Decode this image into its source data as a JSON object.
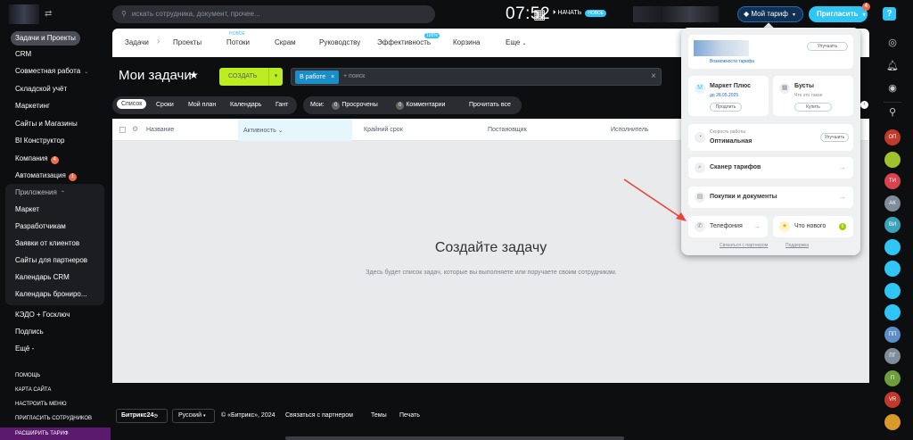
{
  "topbar": {
    "search_placeholder": "искать сотрудника, документ, прочее...",
    "clock": "07:52",
    "start_label": "НАЧАТЬ",
    "start_badge": "НОВОЕ",
    "tariff_label": "Мой тариф",
    "invite_label": "Пригласить",
    "invite_count": "4",
    "help": "?"
  },
  "sidebar": {
    "items": [
      {
        "label": "Задачи и Проекты"
      },
      {
        "label": "CRM"
      },
      {
        "label": "Совместная работа"
      },
      {
        "label": "Складской учёт"
      },
      {
        "label": "Маркетинг"
      },
      {
        "label": "Сайты и Магазины"
      },
      {
        "label": "BI Конструктор"
      },
      {
        "label": "Компания",
        "badge": "4"
      },
      {
        "label": "Автоматизация",
        "badge": "1"
      }
    ],
    "apps_header": "Приложения",
    "apps": [
      "Маркет",
      "Разработчикам",
      "Заявки от клиентов",
      "Сайты для партнеров",
      "Календарь CRM",
      "Календарь брониро..."
    ],
    "extra": [
      "КЭДО + Госключ",
      "Подпись",
      "Ещё -"
    ],
    "small_links": [
      "ПОМОЩЬ",
      "КАРТА САЙТА",
      "НАСТРОИТЬ МЕНЮ",
      "ПРИГЛАСИТЬ СОТРУДНИКОВ"
    ],
    "bottom_label": "РАСШИРИТЬ ТАРИФ"
  },
  "nav": {
    "items": [
      "Задачи",
      "Проекты",
      "Потоки",
      "Скрам",
      "Руководству",
      "Эффективность",
      "Корзина",
      "Еще"
    ],
    "new_badge": "НОВОЕ",
    "pct_badge": "100%"
  },
  "title": {
    "page_title": "Мои задачи",
    "create_label": "СОЗДАТЬ",
    "filter_tag": "В работе",
    "filter_placeholder": "+ поиск"
  },
  "views": {
    "items": [
      "Список",
      "Сроки",
      "Мой план",
      "Календарь",
      "Гант"
    ],
    "mine_label": "Мои:",
    "overdue_count": "0",
    "overdue_label": "Просрочены",
    "comments_count": "0",
    "comments_label": "Комментарии",
    "read_all": "Прочитать все"
  },
  "table": {
    "columns": [
      "Название",
      "Активность",
      "Крайний срок",
      "Постановщик",
      "Исполнитель"
    ],
    "empty_title": "Создайте задачу",
    "empty_desc": "Здесь будет список задач, которые вы выполняете или поручаете своим сотрудникам."
  },
  "footer": {
    "logo": "Битрикс24",
    "lang": "Русский",
    "copyright": "© «Битрикс», 2024",
    "partner": "Связаться с партнером",
    "themes": "Темы",
    "print": "Печать"
  },
  "rail": {
    "avatars": [
      {
        "label": "ОП",
        "color": "#c0392b"
      },
      {
        "label": "",
        "color": "#9fc22d"
      },
      {
        "label": "ТИ",
        "color": "#d9434f"
      },
      {
        "label": "АК",
        "color": "#7f8c9a"
      },
      {
        "label": "ВИ",
        "color": "#3aa3b8"
      },
      {
        "label": "",
        "color": "#2fc6f6"
      },
      {
        "label": "",
        "color": "#2fc6f6"
      },
      {
        "label": "",
        "color": "#2fc6f6"
      },
      {
        "label": "",
        "color": "#2fc6f6"
      },
      {
        "label": "ПП",
        "color": "#5b8fc6"
      },
      {
        "label": "ПГ",
        "color": "#7f8c9a"
      },
      {
        "label": "П",
        "color": "#6c9e3b"
      },
      {
        "label": "VR",
        "color": "#c0392b"
      },
      {
        "label": "",
        "color": "#d99a2b"
      }
    ]
  },
  "popup": {
    "improve_btn": "Улучшить",
    "features_link": "Возможности тарифа",
    "market_title": "Маркет Плюс",
    "market_until": "до 26.05.2025",
    "market_btn": "Продлить",
    "boost_title": "Бусты",
    "boost_link": "Что это такое",
    "boost_btn": "Купить",
    "speed_label": "Скорость работы",
    "speed_value": "Оптимальная",
    "speed_btn": "Улучшить",
    "scanner": "Сканер тарифов",
    "purchases": "Покупки и документы",
    "telephony": "Телефония",
    "whatsnew": "Что нового",
    "whatsnew_badge": "6",
    "partner_link": "Связаться с партнером",
    "support_link": "Поддержка"
  },
  "colors": {
    "accent": "#2fc6f6",
    "create": "#bbed21",
    "arrow": "#e8443a"
  }
}
